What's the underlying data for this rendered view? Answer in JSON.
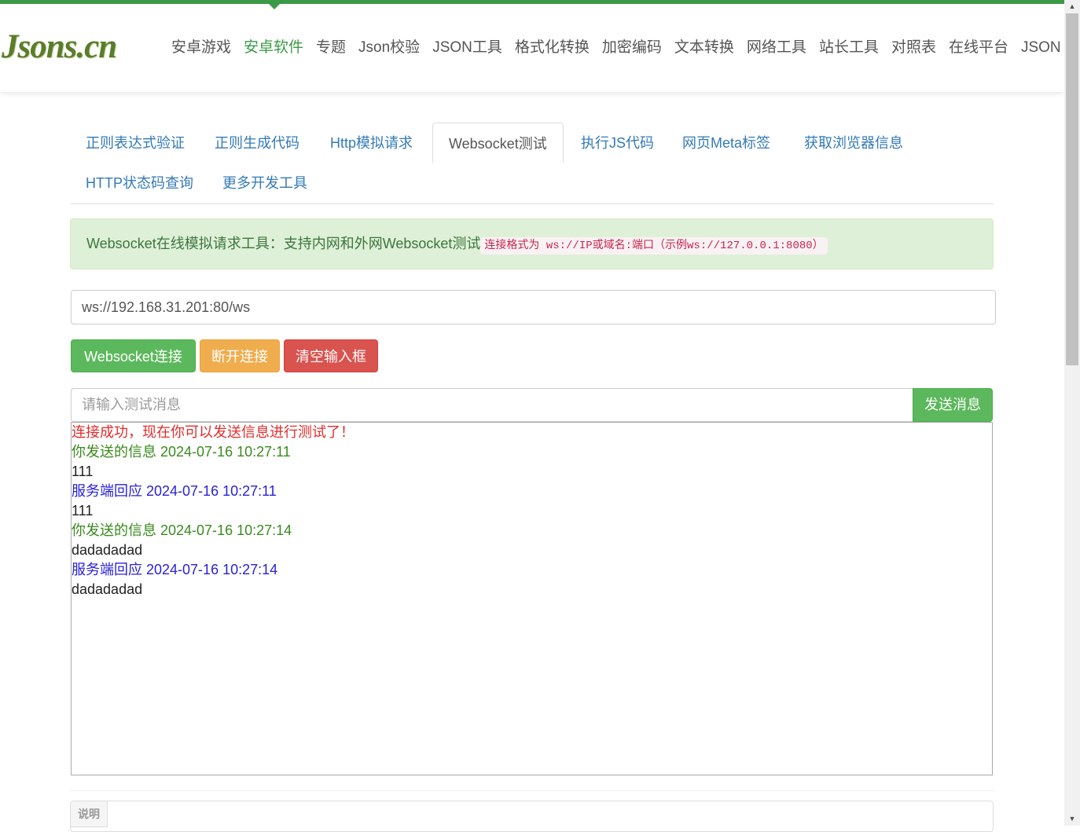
{
  "header": {
    "logo": "Jsons.cn",
    "nav": [
      {
        "label": "安卓游戏",
        "active": false
      },
      {
        "label": "安卓软件",
        "active": true
      },
      {
        "label": "专题",
        "active": false
      },
      {
        "label": "Json校验",
        "active": false
      },
      {
        "label": "JSON工具",
        "active": false
      },
      {
        "label": "格式化转换",
        "active": false
      },
      {
        "label": "加密编码",
        "active": false
      },
      {
        "label": "文本转换",
        "active": false
      },
      {
        "label": "网络工具",
        "active": false
      },
      {
        "label": "站长工具",
        "active": false
      },
      {
        "label": "对照表",
        "active": false
      },
      {
        "label": "在线平台",
        "active": false
      },
      {
        "label": "JSON",
        "active": false
      }
    ]
  },
  "tabs": [
    {
      "label": "正则表达式验证"
    },
    {
      "label": "正则生成代码"
    },
    {
      "label": "Http模拟请求"
    },
    {
      "label": "Websocket测试"
    },
    {
      "label": "执行JS代码"
    },
    {
      "label": "网页Meta标签"
    },
    {
      "label": "获取浏览器信息"
    },
    {
      "label": "HTTP状态码查询"
    },
    {
      "label": "更多开发工具"
    }
  ],
  "active_tab": "Websocket测试",
  "alert": {
    "text": "Websocket在线模拟请求工具：支持内网和外网Websocket测试",
    "code": "连接格式为 ws://IP或域名:端口（示例ws://127.0.0.1:8080）"
  },
  "url_input": {
    "value": "ws://192.168.31.201:80/ws"
  },
  "buttons": {
    "connect": "Websocket连接",
    "disconnect": "断开连接",
    "clear": "清空输入框",
    "send": "发送消息"
  },
  "message_input": {
    "placeholder": "请输入测试消息",
    "value": ""
  },
  "log": [
    {
      "text": "连接成功，现在你可以发送信息进行测试了！",
      "kind": "status",
      "color": "#e42c2c"
    },
    {
      "text": "你发送的信息 2024-07-16 10:27:11",
      "kind": "sent-header",
      "color": "#3a8a1e"
    },
    {
      "text": "111",
      "kind": "body",
      "color": "#222222"
    },
    {
      "text": "服务端回应 2024-07-16 10:27:11",
      "kind": "reply-header",
      "color": "#2a21d8"
    },
    {
      "text": "111",
      "kind": "body",
      "color": "#222222"
    },
    {
      "text": "你发送的信息 2024-07-16 10:27:14",
      "kind": "sent-header",
      "color": "#3a8a1e"
    },
    {
      "text": "dadadadad",
      "kind": "body",
      "color": "#222222"
    },
    {
      "text": "服务端回应 2024-07-16 10:27:14",
      "kind": "reply-header",
      "color": "#2a21d8"
    },
    {
      "text": "dadadadad",
      "kind": "body",
      "color": "#222222"
    }
  ],
  "description": {
    "label": "说明"
  },
  "colors": {
    "brand_green": "#3c9a47",
    "link_blue": "#337ab7",
    "success": "#5cb85c",
    "warning": "#f0ad4e",
    "danger": "#d9534f",
    "alert_bg": "#dff0d8"
  }
}
